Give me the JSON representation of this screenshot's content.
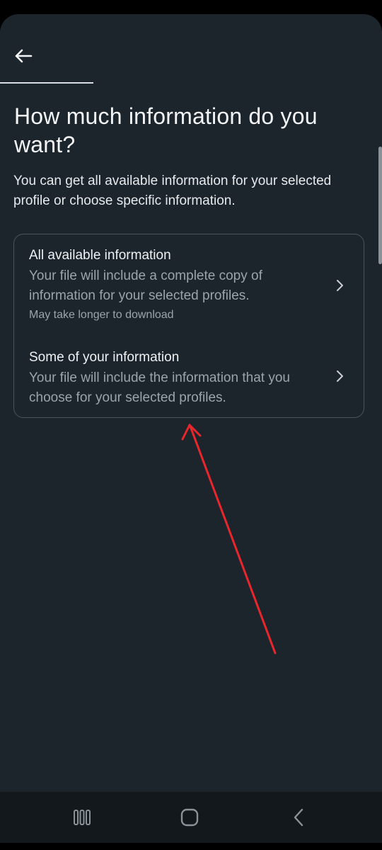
{
  "header": {
    "back_icon": "arrow-left-icon"
  },
  "page": {
    "title": "How much information do you want?",
    "subtitle": "You can get all available information for your selected profile or choose specific information."
  },
  "options": [
    {
      "title": "All available information",
      "description": "Your file will include a complete copy of information for your selected profiles.",
      "note": "May take longer to download",
      "icon": "chevron-right-icon"
    },
    {
      "title": "Some of your information",
      "description": "Your file will include the information that you choose for your selected profiles.",
      "icon": "chevron-right-icon"
    }
  ],
  "navbar": {
    "recents_icon": "recent-apps-icon",
    "home_icon": "home-icon",
    "back_icon": "back-icon"
  },
  "colors": {
    "background": "#1c252c",
    "text_primary": "#f3f5f7",
    "text_secondary": "#9aa4ad",
    "card_border": "#4a545c",
    "annotation_arrow": "#e8262b"
  }
}
